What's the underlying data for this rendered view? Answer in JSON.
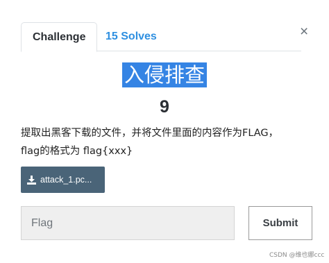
{
  "tabs": {
    "challenge": "Challenge",
    "solves": "15 Solves"
  },
  "close_glyph": "×",
  "challenge": {
    "name": "入侵排查",
    "points": "9",
    "description_line1": "提取出黑客下载的文件，并将文件里面的内容作为FLAG，",
    "description_line2": "flag的格式为 flag{xxx}"
  },
  "file": {
    "label": "attack_1.pc...",
    "icon": "download-icon"
  },
  "form": {
    "flag_placeholder": "Flag",
    "flag_value": "",
    "submit_label": "Submit"
  },
  "watermark": "CSDN @维也娜ccc",
  "colors": {
    "title_highlight": "#3584e4",
    "link": "#2e8fe0",
    "file_button": "#4a6478"
  }
}
